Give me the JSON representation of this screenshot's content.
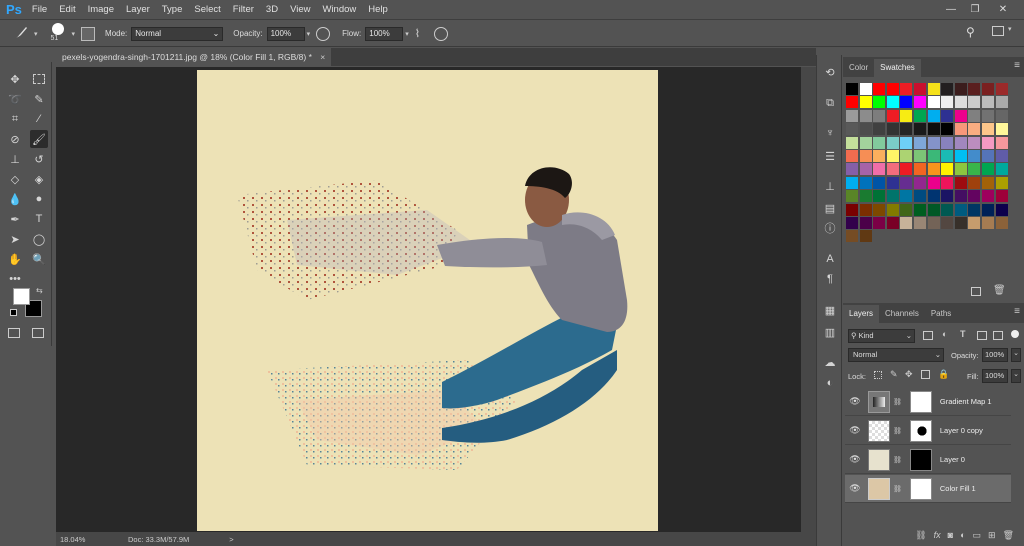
{
  "app": {
    "logo": "Ps"
  },
  "menu": [
    "File",
    "Edit",
    "Image",
    "Layer",
    "Type",
    "Select",
    "Filter",
    "3D",
    "View",
    "Window",
    "Help"
  ],
  "window_controls": {
    "minimize": "—",
    "restore": "❐",
    "close": "✕"
  },
  "options": {
    "brush_size": "51",
    "mode_label": "Mode:",
    "mode_value": "Normal",
    "opacity_label": "Opacity:",
    "opacity_value": "100%",
    "flow_label": "Flow:",
    "flow_value": "100%"
  },
  "document_tab": {
    "title": "pexels-yogendra-singh-1701211.jpg @ 18% (Color Fill 1, RGB/8) *",
    "close": "×"
  },
  "status": {
    "zoom": "18.04%",
    "doc": "Doc: 33.3M/57.9M",
    "arrow": ">"
  },
  "swatch_panel": {
    "tabs": [
      "Color",
      "Swatches"
    ],
    "active_tab": "Swatches"
  },
  "swatch_colors": [
    [
      "#000000",
      "#ffffff",
      "#ff0000",
      "#ff0000",
      "#ee1d24",
      "#c8102e",
      "#f5e11a",
      "#231f20",
      "#3b1d1d",
      "#5a1f1f",
      "#7a2020",
      "#9b2a2a"
    ],
    [
      "#ff0000",
      "#ffff00",
      "#00ff00",
      "#00ffff",
      "#0000ff",
      "#ff00ff",
      "#ffffff",
      "#eeeeee",
      "#dddddd",
      "#cccccc",
      "#bbbbbb",
      "#aaaaaa"
    ],
    [
      "#9b9b9b",
      "#8c8c8c",
      "#7d7d7d",
      "#ed1c24",
      "#f7ec13",
      "#00a651",
      "#00aeef",
      "#2e3192",
      "#ec008c",
      "#808080",
      "#727272",
      "#666666"
    ],
    [
      "#595959",
      "#4d4d4d",
      "#404040",
      "#333333",
      "#262626",
      "#1a1a1a",
      "#0d0d0d",
      "#000000",
      "#f7977a",
      "#f9ad81",
      "#fdc68a",
      "#fff79a"
    ],
    [
      "#c4df9b",
      "#a3d39c",
      "#82ca9d",
      "#7bcdc8",
      "#6ecff6",
      "#7ea7d8",
      "#8493ca",
      "#8882be",
      "#a187be",
      "#bc8dbf",
      "#f49ac2",
      "#f6989d"
    ],
    [
      "#f26c4f",
      "#f68e55",
      "#fbaf5d",
      "#fff467",
      "#acd372",
      "#7cc576",
      "#3bb878",
      "#1abbb4",
      "#00bff3",
      "#438ccb",
      "#5574b9",
      "#605ca8"
    ],
    [
      "#855fa8",
      "#a763a8",
      "#f06ea9",
      "#f26d7d",
      "#ed1c24",
      "#f26522",
      "#f7941d",
      "#fff200",
      "#8dc63f",
      "#39b54a",
      "#00a651",
      "#00a99d"
    ],
    [
      "#00aeef",
      "#0072bc",
      "#0054a6",
      "#2e3192",
      "#662d91",
      "#92278f",
      "#ec008c",
      "#ed145b",
      "#9e0b0f",
      "#a0410d",
      "#a36209",
      "#aba000"
    ],
    [
      "#598527",
      "#1a7b30",
      "#007236",
      "#00746b",
      "#0076a3",
      "#004b80",
      "#003471",
      "#1b1464",
      "#440e62",
      "#630460",
      "#9e005d",
      "#9e0039"
    ],
    [
      "#790000",
      "#7b2e00",
      "#7d4900",
      "#827b00",
      "#406618",
      "#005e20",
      "#005826",
      "#005952",
      "#005b7f",
      "#003663",
      "#002157",
      "#0d004c"
    ],
    [
      "#32004b",
      "#4b0049",
      "#7b0046",
      "#7a0026",
      "#c7b299",
      "#998675",
      "#736357",
      "#534741",
      "#37302a",
      "#c69c6d",
      "#a67c52",
      "#8c6239"
    ],
    [
      "#754c24",
      "#603913"
    ]
  ],
  "layers_panel": {
    "tabs": [
      "Layers",
      "Channels",
      "Paths"
    ],
    "active_tab": "Layers",
    "filter": "Kind",
    "blend_mode": "Normal",
    "opacity_label": "Opacity:",
    "opacity_value": "100%",
    "lock_label": "Lock:",
    "fill_label": "Fill:",
    "fill_value": "100%",
    "layers": [
      {
        "name": "Gradient Map 1",
        "selected": false
      },
      {
        "name": "Layer 0 copy",
        "selected": false
      },
      {
        "name": "Layer 0",
        "selected": false
      },
      {
        "name": "Color Fill 1",
        "selected": true
      }
    ]
  },
  "colors": {
    "canvas": "#ede2b6",
    "workspace": "#282828",
    "panel": "#535353",
    "accent": "#31a8ff"
  }
}
